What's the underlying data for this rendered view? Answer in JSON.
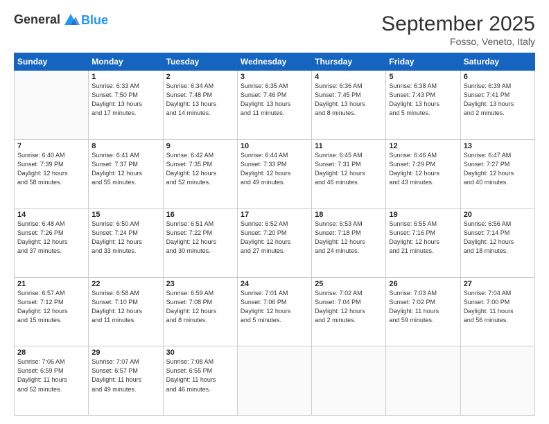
{
  "header": {
    "logo_line1": "General",
    "logo_line2": "Blue",
    "month": "September 2025",
    "location": "Fosso, Veneto, Italy"
  },
  "weekdays": [
    "Sunday",
    "Monday",
    "Tuesday",
    "Wednesday",
    "Thursday",
    "Friday",
    "Saturday"
  ],
  "weeks": [
    [
      {
        "day": "",
        "info": ""
      },
      {
        "day": "1",
        "info": "Sunrise: 6:33 AM\nSunset: 7:50 PM\nDaylight: 13 hours\nand 17 minutes."
      },
      {
        "day": "2",
        "info": "Sunrise: 6:34 AM\nSunset: 7:48 PM\nDaylight: 13 hours\nand 14 minutes."
      },
      {
        "day": "3",
        "info": "Sunrise: 6:35 AM\nSunset: 7:46 PM\nDaylight: 13 hours\nand 11 minutes."
      },
      {
        "day": "4",
        "info": "Sunrise: 6:36 AM\nSunset: 7:45 PM\nDaylight: 13 hours\nand 8 minutes."
      },
      {
        "day": "5",
        "info": "Sunrise: 6:38 AM\nSunset: 7:43 PM\nDaylight: 13 hours\nand 5 minutes."
      },
      {
        "day": "6",
        "info": "Sunrise: 6:39 AM\nSunset: 7:41 PM\nDaylight: 13 hours\nand 2 minutes."
      }
    ],
    [
      {
        "day": "7",
        "info": "Sunrise: 6:40 AM\nSunset: 7:39 PM\nDaylight: 12 hours\nand 58 minutes."
      },
      {
        "day": "8",
        "info": "Sunrise: 6:41 AM\nSunset: 7:37 PM\nDaylight: 12 hours\nand 55 minutes."
      },
      {
        "day": "9",
        "info": "Sunrise: 6:42 AM\nSunset: 7:35 PM\nDaylight: 12 hours\nand 52 minutes."
      },
      {
        "day": "10",
        "info": "Sunrise: 6:44 AM\nSunset: 7:33 PM\nDaylight: 12 hours\nand 49 minutes."
      },
      {
        "day": "11",
        "info": "Sunrise: 6:45 AM\nSunset: 7:31 PM\nDaylight: 12 hours\nand 46 minutes."
      },
      {
        "day": "12",
        "info": "Sunrise: 6:46 AM\nSunset: 7:29 PM\nDaylight: 12 hours\nand 43 minutes."
      },
      {
        "day": "13",
        "info": "Sunrise: 6:47 AM\nSunset: 7:27 PM\nDaylight: 12 hours\nand 40 minutes."
      }
    ],
    [
      {
        "day": "14",
        "info": "Sunrise: 6:48 AM\nSunset: 7:26 PM\nDaylight: 12 hours\nand 37 minutes."
      },
      {
        "day": "15",
        "info": "Sunrise: 6:50 AM\nSunset: 7:24 PM\nDaylight: 12 hours\nand 33 minutes."
      },
      {
        "day": "16",
        "info": "Sunrise: 6:51 AM\nSunset: 7:22 PM\nDaylight: 12 hours\nand 30 minutes."
      },
      {
        "day": "17",
        "info": "Sunrise: 6:52 AM\nSunset: 7:20 PM\nDaylight: 12 hours\nand 27 minutes."
      },
      {
        "day": "18",
        "info": "Sunrise: 6:53 AM\nSunset: 7:18 PM\nDaylight: 12 hours\nand 24 minutes."
      },
      {
        "day": "19",
        "info": "Sunrise: 6:55 AM\nSunset: 7:16 PM\nDaylight: 12 hours\nand 21 minutes."
      },
      {
        "day": "20",
        "info": "Sunrise: 6:56 AM\nSunset: 7:14 PM\nDaylight: 12 hours\nand 18 minutes."
      }
    ],
    [
      {
        "day": "21",
        "info": "Sunrise: 6:57 AM\nSunset: 7:12 PM\nDaylight: 12 hours\nand 15 minutes."
      },
      {
        "day": "22",
        "info": "Sunrise: 6:58 AM\nSunset: 7:10 PM\nDaylight: 12 hours\nand 11 minutes."
      },
      {
        "day": "23",
        "info": "Sunrise: 6:59 AM\nSunset: 7:08 PM\nDaylight: 12 hours\nand 8 minutes."
      },
      {
        "day": "24",
        "info": "Sunrise: 7:01 AM\nSunset: 7:06 PM\nDaylight: 12 hours\nand 5 minutes."
      },
      {
        "day": "25",
        "info": "Sunrise: 7:02 AM\nSunset: 7:04 PM\nDaylight: 12 hours\nand 2 minutes."
      },
      {
        "day": "26",
        "info": "Sunrise: 7:03 AM\nSunset: 7:02 PM\nDaylight: 11 hours\nand 59 minutes."
      },
      {
        "day": "27",
        "info": "Sunrise: 7:04 AM\nSunset: 7:00 PM\nDaylight: 11 hours\nand 56 minutes."
      }
    ],
    [
      {
        "day": "28",
        "info": "Sunrise: 7:06 AM\nSunset: 6:59 PM\nDaylight: 11 hours\nand 52 minutes."
      },
      {
        "day": "29",
        "info": "Sunrise: 7:07 AM\nSunset: 6:57 PM\nDaylight: 11 hours\nand 49 minutes."
      },
      {
        "day": "30",
        "info": "Sunrise: 7:08 AM\nSunset: 6:55 PM\nDaylight: 11 hours\nand 46 minutes."
      },
      {
        "day": "",
        "info": ""
      },
      {
        "day": "",
        "info": ""
      },
      {
        "day": "",
        "info": ""
      },
      {
        "day": "",
        "info": ""
      }
    ]
  ]
}
